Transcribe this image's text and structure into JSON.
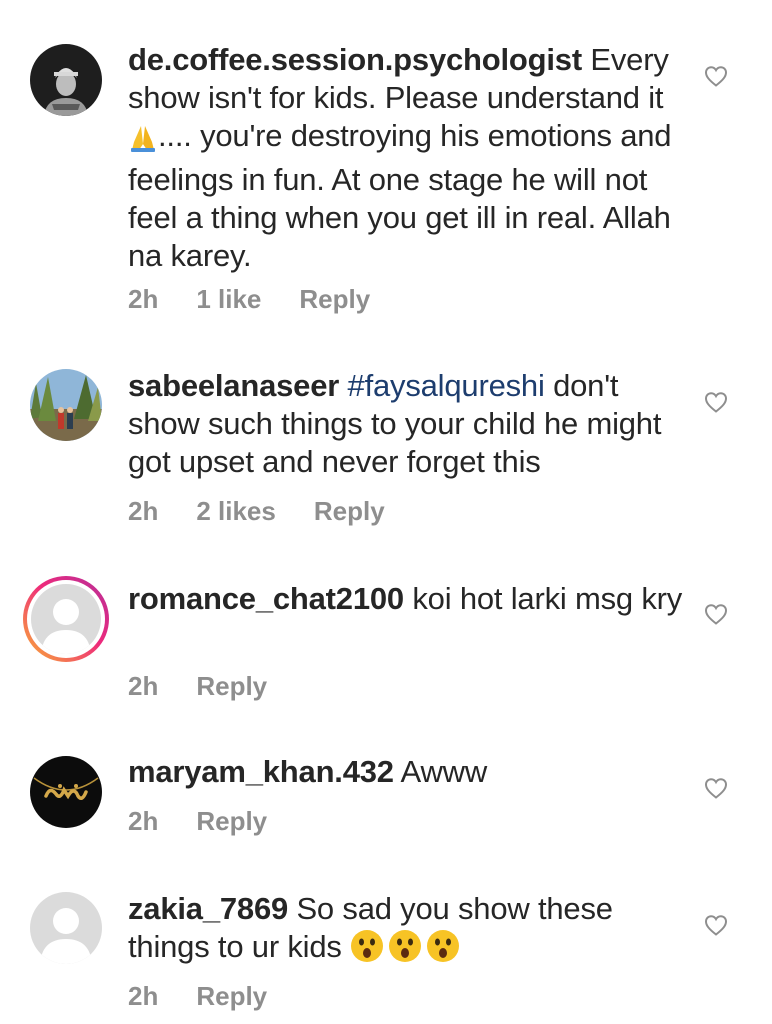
{
  "comments": [
    {
      "username": "de.coffee.session.psychologist",
      "text_before_emoji": "Every show isn't for kids. Please understand it ",
      "emoji": "folded-hands",
      "text_after_emoji": ".... you're destroying his emotions and feelings in fun. At one stage he will not feel a thing when you get ill in real. Allah na karey.",
      "time": "2h",
      "likes": "1 like",
      "reply": "Reply",
      "avatar": "man-in-hat-dark-photo"
    },
    {
      "username": "sabeelanaseer",
      "hashtag": "#faysalqureshi",
      "text": " don't show such things to your child he might got upset and never forget this",
      "time": "2h",
      "likes": "2 likes",
      "reply": "Reply",
      "avatar": "outdoor-trees-photo"
    },
    {
      "username": "romance_chat2100",
      "text": " koi hot larki msg kry",
      "time": "2h",
      "reply": "Reply",
      "avatar": "default-avatar-with-story-ring"
    },
    {
      "username": "maryam_khan.432",
      "text": " Awww",
      "time": "2h",
      "reply": "Reply",
      "avatar": "gold-name-necklace-photo"
    },
    {
      "username": "zakia_7869",
      "text": " So sad you show these things to ur kids ",
      "emoji_count": 3,
      "emoji": "astonished-face",
      "time": "2h",
      "reply": "Reply",
      "avatar": "default-avatar"
    }
  ],
  "colors": {
    "text": "#262626",
    "meta": "#8e8e8e",
    "hashtag": "#1d3d6e",
    "ring_start": "#f9b234",
    "ring_end": "#b42f9b"
  },
  "icons": {
    "like": "heart-outline-icon"
  }
}
